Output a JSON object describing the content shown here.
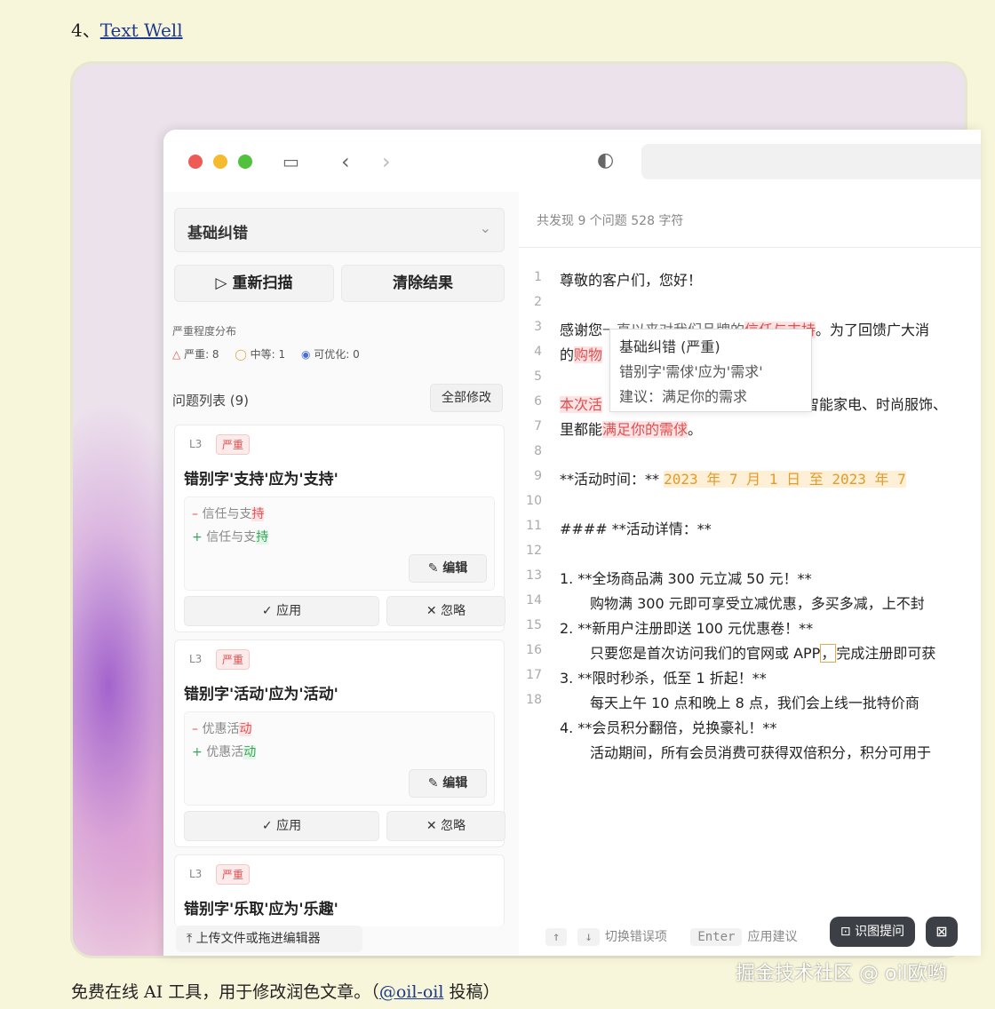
{
  "heading": {
    "number": "4、",
    "link": "Text Well"
  },
  "app": {
    "mode_select": "基础纠错",
    "rescan": "重新扫描",
    "clear": "清除结果",
    "severity_title": "严重程度分布",
    "severity": {
      "serious": "严重: 8",
      "medium": "中等: 1",
      "optimizable": "可优化: 0"
    },
    "list_title": "问题列表 (9)",
    "fix_all": "全部修改",
    "cards": [
      {
        "level": "L3",
        "badge": "严重",
        "title": "错别字'支持'应为'支持'",
        "old_prefix": "信任与支",
        "old_char": "持",
        "new_prefix": "信任与支",
        "new_char": "持",
        "edit": "编辑",
        "apply": "应用",
        "ignore": "忽略"
      },
      {
        "level": "L3",
        "badge": "严重",
        "title": "错别字'活动'应为'活动'",
        "old_prefix": "优惠活",
        "old_char": "动",
        "new_prefix": "优惠活",
        "new_char": "动",
        "edit": "编辑",
        "apply": "应用",
        "ignore": "忽略"
      },
      {
        "level": "L3",
        "badge": "严重",
        "title": "错别字'乐取'应为'乐趣'"
      }
    ],
    "upload": "上传文件或拖进编辑器",
    "status": "共发现 9 个问题   528 字符",
    "lines": {
      "l1": "尊敬的客户们，您好！",
      "l3a": "感谢您",
      "l3b": "一直以来对我们品牌的",
      "l3red": "信任与支持",
      "l3c": "。为了回馈广大消",
      "l3d": "的",
      "l3red2": "购物",
      "l5red": "本次活",
      "l5b": "智能家电、时尚服饰、",
      "l5c": "里都能",
      "l5red2": "满足你的需俅",
      "l5d": "。",
      "l7a": "**活动时间：**",
      "l7b": "2023 年 7 月 1 日 至 2023 年 7",
      "l9": "#### **活动详情：**",
      "l11": "1. **全场商品满 300 元立减 50 元！**",
      "l12": "购物满 300 元即可享受立减优惠，多买多减，上不封",
      "l13": "2. **新用户注册即送 100 元优惠卷！**",
      "l14a": "只要您是首次访问我们的官网或 APP",
      "l14b": "，",
      "l14c": "完成注册即可获",
      "l15": "3. **限时秒杀，低至 1 折起！**",
      "l16": "每天上午 10 点和晚上 8 点，我们会上线一批特价商",
      "l17": "4. **会员积分翻倍，兑换豪礼！**",
      "l18": "活动期间，所有会员消费可获得双倍积分，积分可用于"
    },
    "line_numbers": [
      "1",
      "2",
      "3",
      "4",
      "5",
      "6",
      "7",
      "8",
      "9",
      "10",
      "11",
      "12",
      "13",
      "14",
      "15",
      "16",
      "17",
      "18"
    ],
    "tooltip": {
      "title": "基础纠错 (严重)",
      "detail": "错别字'需俅'应为'需求'",
      "suggest": "建议：满足你的需求"
    },
    "footer": {
      "up": "↑",
      "down": "↓",
      "switch": "切换错误项",
      "enter": "Enter",
      "apply": "应用建议"
    }
  },
  "ocr_button": "识图提问",
  "watermark": "掘金技术社区 @ oil欧哟",
  "caption": {
    "text": "免费在线 AI 工具，用于修改润色文章。（",
    "link": "@oil-oil",
    "tail": " 投稿）"
  }
}
